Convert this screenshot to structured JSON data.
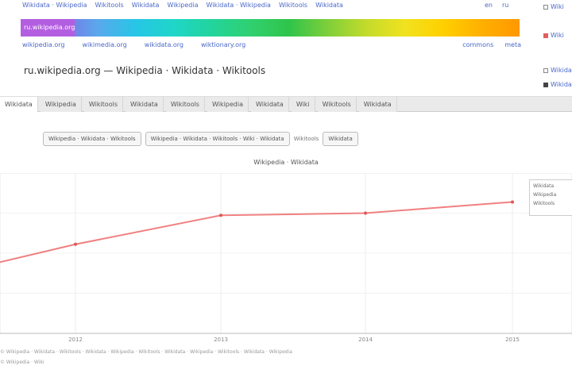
{
  "top_links": [
    "Wikidata · Wikipedia",
    "Wikitools",
    "Wikidata",
    "Wikipedia",
    "Wikidata · Wikipedia",
    "Wikitools",
    "Wikidata"
  ],
  "top_links_right": [
    "en",
    "ru"
  ],
  "rainbow_selected": "ru.wikipedia.org",
  "rainbow_colors": [
    "#5b7ee6",
    "#7f6ee6",
    "#5aa8ec",
    "#26c6e6",
    "#1fd6c8",
    "#22d49b",
    "#30d070",
    "#2fc44a",
    "#7ecf3a",
    "#c3db2b",
    "#f0e21f",
    "#ffd000",
    "#ffb000",
    "#ff9800"
  ],
  "bottom_links": [
    "wikipedia.org",
    "wikimedia.org",
    "wikidata.org",
    "wiktionary.org"
  ],
  "bottom_links_right": [
    "commons",
    "meta"
  ],
  "right_items": [
    {
      "label": "Wiki",
      "color": "#e06060"
    },
    {
      "label": "Wikidata",
      "color": "#444444"
    }
  ],
  "page_title": "ru.wikipedia.org — Wikipedia · Wikidata · Wikitools",
  "tabs": [
    "Wikidata",
    "Wikipedia",
    "Wikitools",
    "Wikidata",
    "Wikitools",
    "Wikipedia",
    "Wikidata",
    "Wiki",
    "Wikitools",
    "Wikidata"
  ],
  "active_tab": 0,
  "filters": [
    "Wikipedia · Wikidata · Wikitools",
    "Wikipedia · Wikidata · Wikitools · Wiki · Wikidata",
    "Wikitools",
    "Wikidata"
  ],
  "filter_selected_index": 2,
  "chart_data": {
    "type": "line",
    "title": "Wikipedia · Wikidata",
    "x": [
      "",
      "2012",
      "2013",
      "2014",
      "2015"
    ],
    "series": [
      {
        "color": "#f08080",
        "values": [
          52,
          60,
          73,
          74,
          79
        ]
      }
    ],
    "ylim": [
      20,
      92
    ],
    "grid": true,
    "legend_placement": "top-right",
    "legend": [
      "Wikidata",
      "Wikipedia",
      "Wikitools"
    ]
  },
  "footer": {
    "line1": "© Wikipedia · Wikidata · Wikitools · Wikidata · Wikipedia · Wikitools · Wikidata · Wikipedia · Wikitools · Wikidata · Wikipedia",
    "line2": "© Wikipedia · Wiki"
  }
}
